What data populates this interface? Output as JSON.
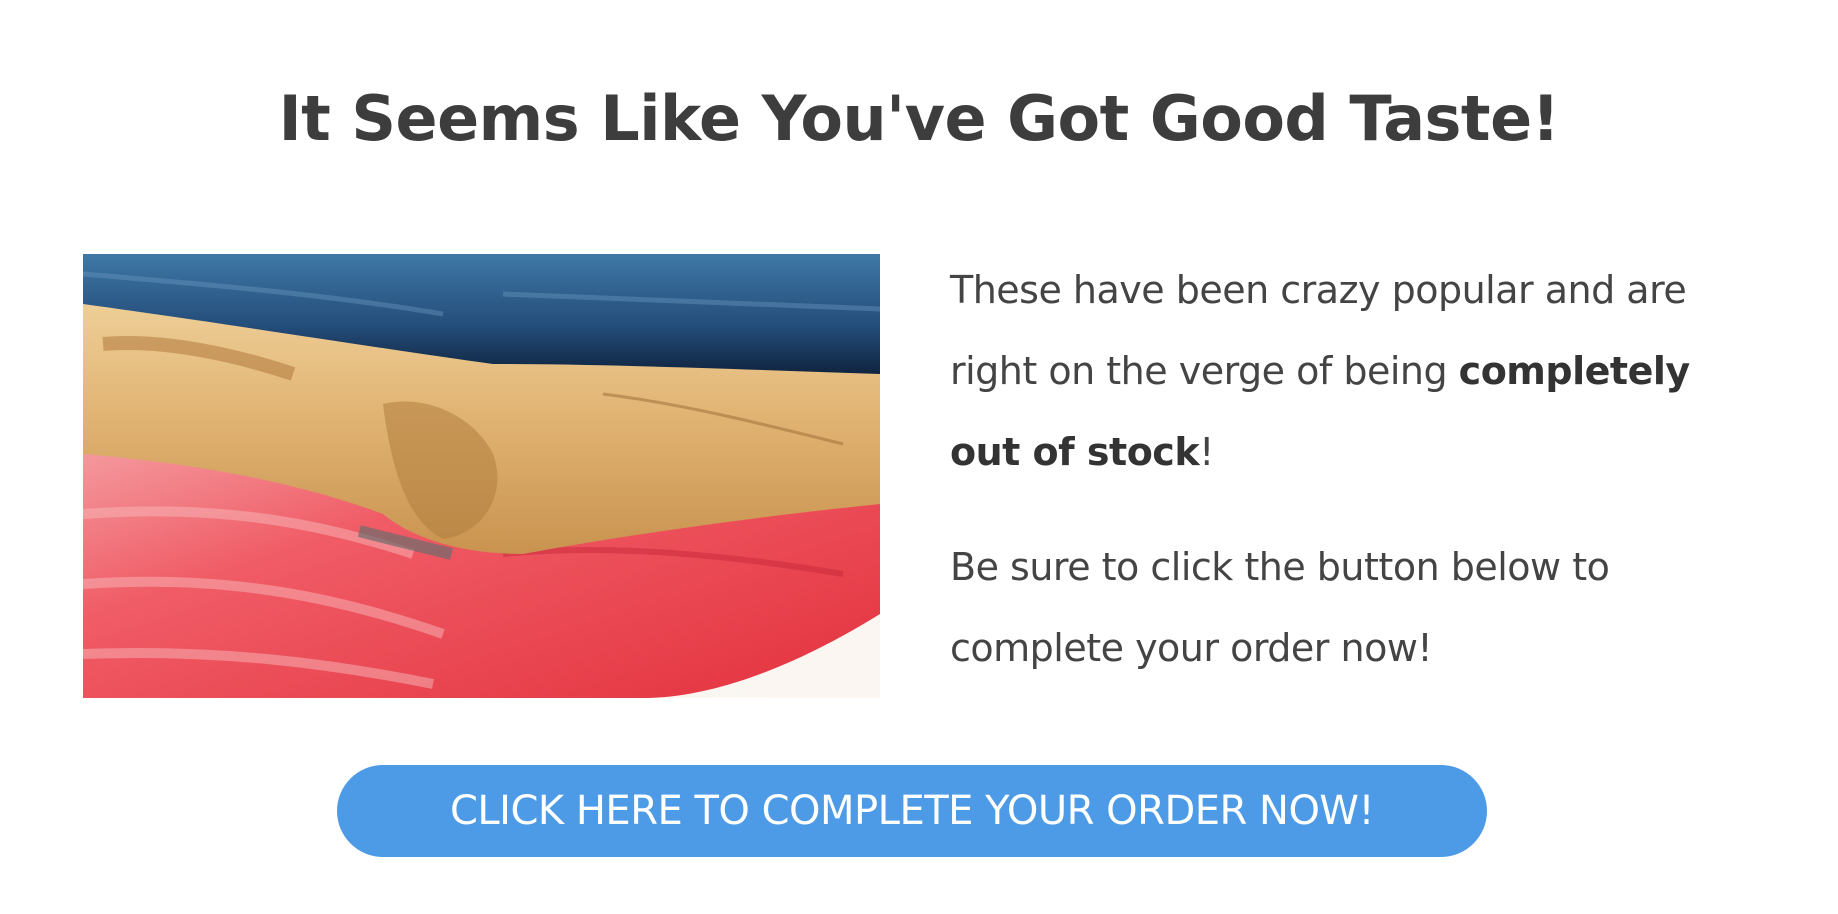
{
  "headline": "It Seems Like You've Got Good Taste!",
  "image": {
    "icon": "folded-clothes-photo",
    "colors": {
      "denim": "#2f5f8f",
      "khaki": "#e2b877",
      "red": "#ee4a55"
    }
  },
  "copy": {
    "p1_text_a": "These have been crazy popular and are right on the verge of being ",
    "p1_bold": "completely out of stock",
    "p1_text_b": "!",
    "p2": "Be sure to click the button below to complete your order now!"
  },
  "cta": {
    "label": "CLICK HERE TO COMPLETE YOUR ORDER NOW!",
    "color": "#4d9be6"
  }
}
